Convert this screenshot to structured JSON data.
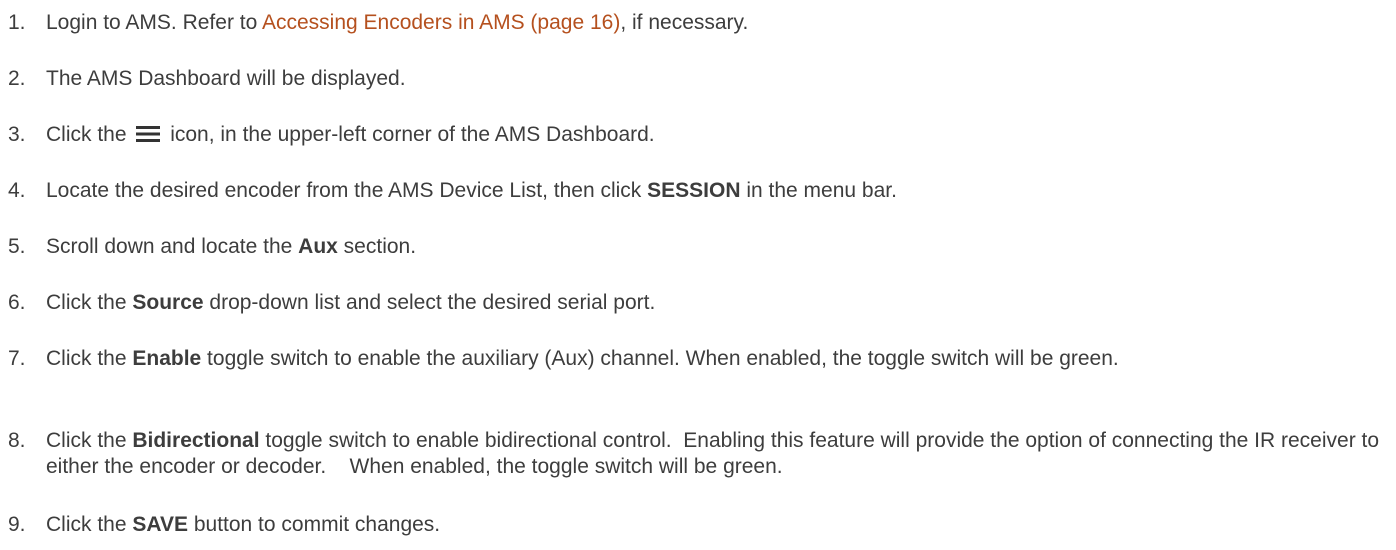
{
  "steps": [
    {
      "number": "1.",
      "parts": [
        {
          "text": "Login to AMS.  Refer to "
        },
        {
          "link": "Accessing Encoders in AMS (page 16)"
        },
        {
          "text": ", if necessary."
        }
      ]
    },
    {
      "number": "2.",
      "parts": [
        {
          "text": "The AMS Dashboard will be displayed."
        }
      ]
    },
    {
      "number": "3.",
      "parts": [
        {
          "text": "Click the "
        },
        {
          "icon": "menu-icon"
        },
        {
          "text": " icon, in the upper-left corner of the AMS Dashboard."
        }
      ]
    },
    {
      "number": "4.",
      "parts": [
        {
          "text": "Locate the desired encoder from the AMS Device List, then click "
        },
        {
          "bold": "SESSION"
        },
        {
          "text": " in the menu bar."
        }
      ]
    },
    {
      "number": "5.",
      "parts": [
        {
          "text": "Scroll down and locate the "
        },
        {
          "bold": "Aux"
        },
        {
          "text": " section."
        }
      ]
    },
    {
      "number": "6.",
      "parts": [
        {
          "text": "Click the "
        },
        {
          "bold": "Source"
        },
        {
          "text": " drop-down list and select the desired serial port."
        }
      ]
    },
    {
      "number": "7.",
      "parts": [
        {
          "text": "Click the "
        },
        {
          "bold": "Enable"
        },
        {
          "text": " toggle switch to enable the auxiliary (Aux) channel.  When enabled, the toggle switch will be green."
        }
      ]
    },
    {
      "number": "8.",
      "parts": [
        {
          "text": "Click the "
        },
        {
          "bold": "Bidirectional"
        },
        {
          "text": " toggle switch to enable bidirectional control.  Enabling this feature will provide the option of connecting the IR receiver to either the encoder or decoder.    When enabled, the toggle switch will be green."
        }
      ]
    },
    {
      "number": "9.",
      "parts": [
        {
          "text": "Click the "
        },
        {
          "bold": "SAVE"
        },
        {
          "text": " button to commit changes."
        }
      ]
    }
  ]
}
